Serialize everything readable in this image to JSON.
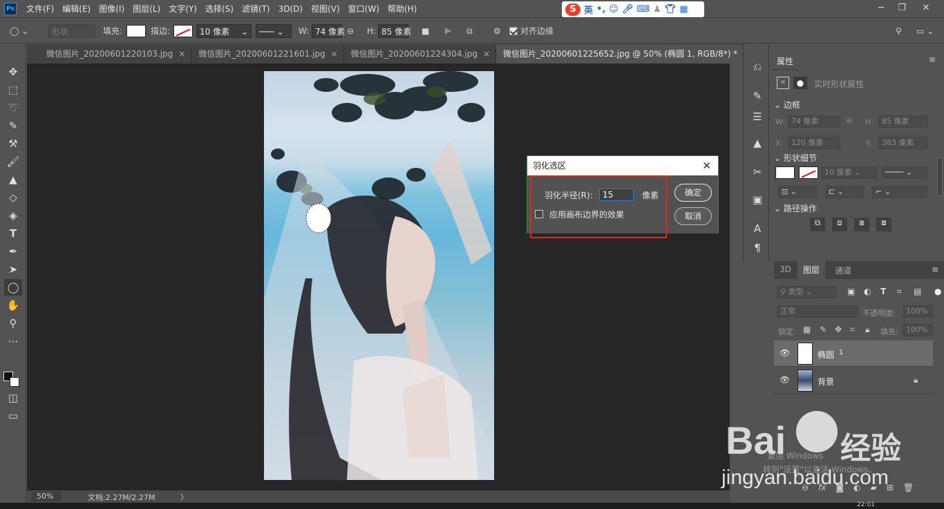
{
  "app": {
    "logo": "Ps"
  },
  "menu": [
    "文件(F)",
    "编辑(E)",
    "图像(I)",
    "图层(L)",
    "文字(Y)",
    "选择(S)",
    "滤镜(T)",
    "3D(D)",
    "视图(V)",
    "窗口(W)",
    "帮助(H)"
  ],
  "ime": {
    "mode": "英",
    "icons": [
      "punctuation-icon",
      "emoji-icon",
      "mic-icon",
      "keyboard-icon",
      "user-icon",
      "shirt-icon",
      "grid-icon"
    ]
  },
  "window_controls": [
    "minimize-icon",
    "restore-icon",
    "close-icon"
  ],
  "options": {
    "shape_mode": "形状",
    "fill_label": "填充:",
    "stroke_label": "描边:",
    "stroke_width": "10 像素",
    "w_label": "W:",
    "w_value": "74 像素",
    "h_label": "H:",
    "h_value": "85 像素",
    "align_edges": "对齐边缘"
  },
  "tabs": [
    {
      "label": "微信图片_20200601220103.jpg",
      "active": false
    },
    {
      "label": "微信图片_20200601221601.jpg",
      "active": false
    },
    {
      "label": "微信图片_20200601224304.jpg",
      "active": false
    },
    {
      "label": "微信图片_20200601225652.jpg @ 50% (椭圆 1, RGB/8*) *",
      "active": true
    }
  ],
  "tab_close": "×",
  "status": {
    "zoom": "50%",
    "doc": "文档:2.27M/2.27M",
    "arrow": "〉"
  },
  "dialog": {
    "title": "羽化选区",
    "radius_label": "羽化半径(R):",
    "radius_value": "15",
    "unit": "像素",
    "checkbox_label": "应用画布边界的效果",
    "ok": "确定",
    "cancel": "取消"
  },
  "properties": {
    "tab": "属性",
    "header": "实时形状属性",
    "section_frame": "边框",
    "w_label": "W:",
    "w_value": "74 像素",
    "h_label": "H:",
    "h_value": "85 像素",
    "x_label": "X:",
    "x_value": "120 像素",
    "y_label": "Y:",
    "y_value": "383 像素",
    "section_shape": "形状细节",
    "stroke_width": "10 像素",
    "section_path": "路径操作"
  },
  "layers_panel": {
    "tabs": [
      "3D",
      "图层",
      "通道"
    ],
    "filter": "类型",
    "blend_mode": "正常",
    "opacity_label": "不透明度:",
    "opacity_value": "100%",
    "lock_label": "锁定:",
    "fill_label": "填充:",
    "fill_value": "100%",
    "layers": [
      {
        "name": "椭圆",
        "suffix": "1",
        "selected": true
      },
      {
        "name": "背景",
        "suffix": "",
        "selected": false
      }
    ]
  },
  "watermark": {
    "brand": "Bai",
    "brand2": "经验",
    "url": "jingyan.baidu.com",
    "activate1": "激活 Windows",
    "activate2": "转到\"设置\"以激活 Windows。"
  },
  "clock": "22:01"
}
